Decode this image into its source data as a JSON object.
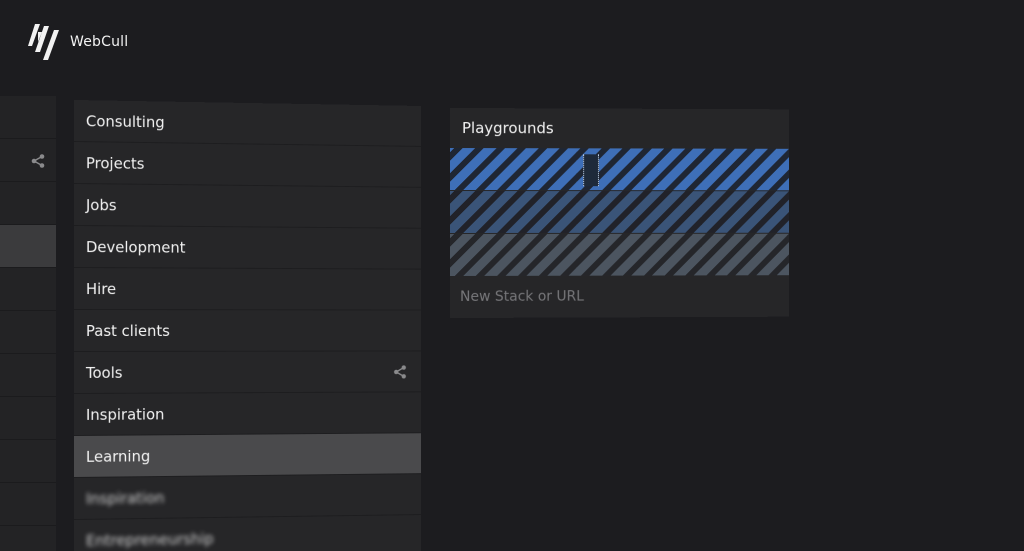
{
  "app": {
    "name": "WebCull"
  },
  "left_column": {
    "rows": 11,
    "active_index": 3
  },
  "list": {
    "items": [
      {
        "label": "Consulting",
        "active": false,
        "share": false,
        "blurred": false
      },
      {
        "label": "Projects",
        "active": false,
        "share": false,
        "blurred": false
      },
      {
        "label": "Jobs",
        "active": false,
        "share": false,
        "blurred": false
      },
      {
        "label": "Development",
        "active": false,
        "share": false,
        "blurred": false
      },
      {
        "label": "Hire",
        "active": false,
        "share": false,
        "blurred": false
      },
      {
        "label": "Past clients",
        "active": false,
        "share": false,
        "blurred": false
      },
      {
        "label": "Tools",
        "active": false,
        "share": true,
        "blurred": false
      },
      {
        "label": "Inspiration",
        "active": false,
        "share": false,
        "blurred": false
      },
      {
        "label": "Learning",
        "active": true,
        "share": false,
        "blurred": false
      },
      {
        "label": "Inspiration",
        "active": false,
        "share": false,
        "blurred": true
      },
      {
        "label": "Entrepreneurship",
        "active": false,
        "share": false,
        "blurred": true
      }
    ]
  },
  "card": {
    "title": "Playgrounds",
    "new_stack_placeholder": "New Stack or URL"
  },
  "colors": {
    "background": "#1c1c1f",
    "panel": "#262628",
    "active": "#4a4a4c",
    "stripe_blue": "#3e6fb8"
  }
}
